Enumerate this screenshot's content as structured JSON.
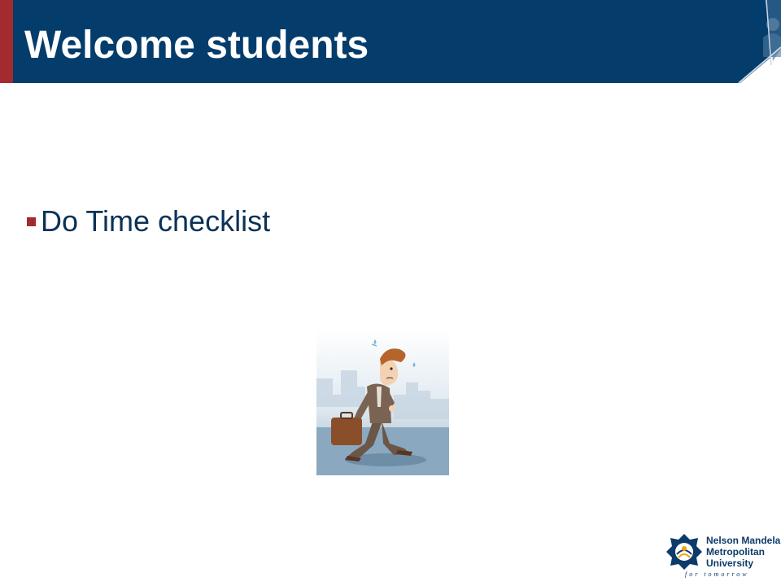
{
  "slide": {
    "title": "Welcome students",
    "bullets": [
      {
        "text": "Do Time checklist"
      }
    ],
    "image": {
      "icon": "worried-businessman-walking-clipart"
    }
  },
  "logo": {
    "lines": [
      "Nelson Mandela",
      "Metropolitan",
      "University"
    ],
    "tagline": "for tomorrow",
    "icon": "nmmu-emblem-icon"
  },
  "colors": {
    "title_bar": "#043c6b",
    "accent": "#a32a2f",
    "body_text": "#0b3257"
  }
}
